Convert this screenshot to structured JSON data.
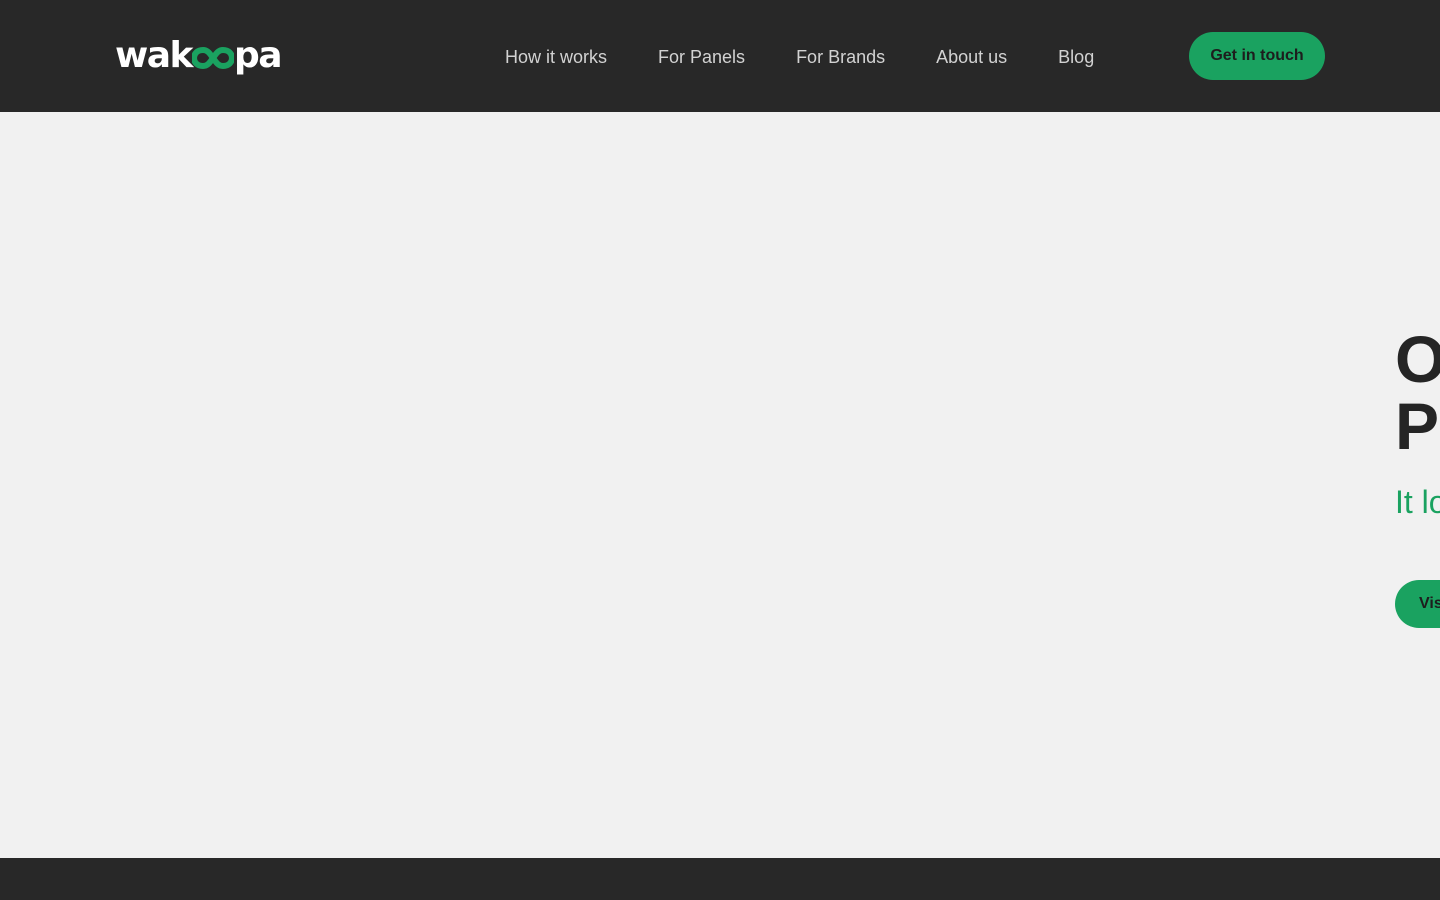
{
  "header": {
    "logo": {
      "text_left": "wak",
      "text_right": "pa",
      "icon": "infinity-loop-icon",
      "accent": "#1aa260"
    },
    "nav": [
      {
        "label": "How it works"
      },
      {
        "label": "For Panels"
      },
      {
        "label": "For Brands"
      },
      {
        "label": "About us"
      },
      {
        "label": "Blog"
      }
    ],
    "cta_label": "Get in touch"
  },
  "hero": {
    "title_line1": "O",
    "title_line2": "Pa",
    "subtitle": "It lo",
    "button_label": "Vis"
  },
  "colors": {
    "header_bg": "#282828",
    "page_bg": "#f1f1f1",
    "accent": "#1aa260",
    "title_text": "#252525",
    "nav_text": "#d2d2d2"
  }
}
